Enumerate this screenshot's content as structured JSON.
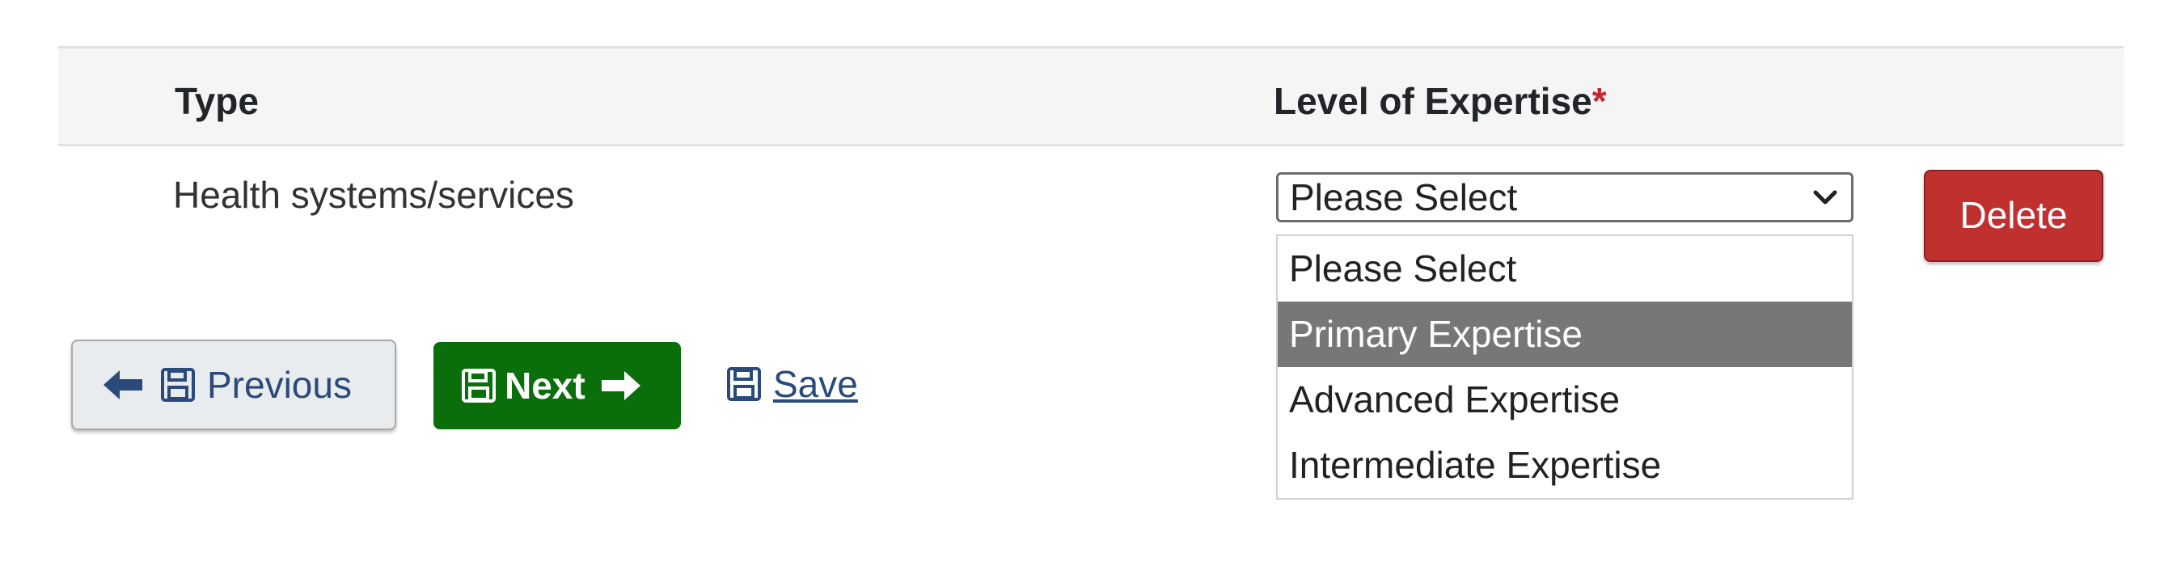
{
  "table": {
    "headers": {
      "type": "Type",
      "level": "Level of Expertise",
      "required_marker": "*"
    },
    "row": {
      "type_value": "Health systems/services",
      "level_select": {
        "selected": "Please Select",
        "options": [
          "Please Select",
          "Primary Expertise",
          "Advanced Expertise",
          "Intermediate Expertise"
        ],
        "highlighted": "Primary Expertise"
      },
      "delete_label": "Delete"
    }
  },
  "actions": {
    "previous_label": "Previous",
    "next_label": "Next",
    "save_label": "Save"
  },
  "colors": {
    "required": "#c82333",
    "delete_bg": "#c0302f",
    "next_bg": "#0a6e0a",
    "link": "#2a4a7a",
    "option_highlight": "#777777"
  },
  "icons": [
    "arrow-left-icon",
    "floppy-disk-icon",
    "arrow-right-icon",
    "chevron-down-icon"
  ]
}
